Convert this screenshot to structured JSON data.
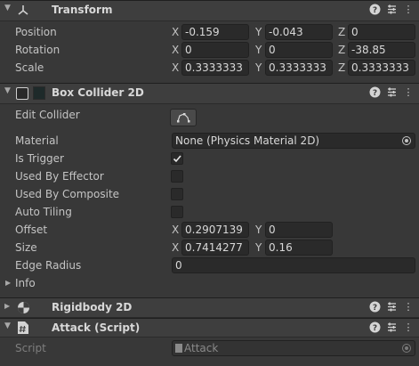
{
  "transform": {
    "title": "Transform",
    "position": {
      "label": "Position",
      "x": "-0.159",
      "y": "-0.043",
      "z": "0"
    },
    "rotation": {
      "label": "Rotation",
      "x": "0",
      "y": "0",
      "z": "-38.85"
    },
    "scale": {
      "label": "Scale",
      "x": "0.3333333",
      "y": "0.3333333",
      "z": "0.3333333"
    }
  },
  "box_collider": {
    "title": "Box Collider 2D",
    "edit_collider_label": "Edit Collider",
    "material_label": "Material",
    "material_value": "None (Physics Material 2D)",
    "is_trigger_label": "Is Trigger",
    "is_trigger": true,
    "used_by_effector_label": "Used By Effector",
    "used_by_composite_label": "Used By Composite",
    "auto_tiling_label": "Auto Tiling",
    "offset": {
      "label": "Offset",
      "x": "0.2907139",
      "y": "0"
    },
    "size": {
      "label": "Size",
      "x": "0.7414277",
      "y": "0.16"
    },
    "edge_radius": {
      "label": "Edge Radius",
      "value": "0"
    },
    "info_label": "Info"
  },
  "rigidbody": {
    "title": "Rigidbody 2D"
  },
  "attack": {
    "title": "Attack (Script)",
    "script_label": "Script",
    "script_value": "Attack"
  },
  "axes": {
    "x": "X",
    "y": "Y",
    "z": "Z"
  }
}
